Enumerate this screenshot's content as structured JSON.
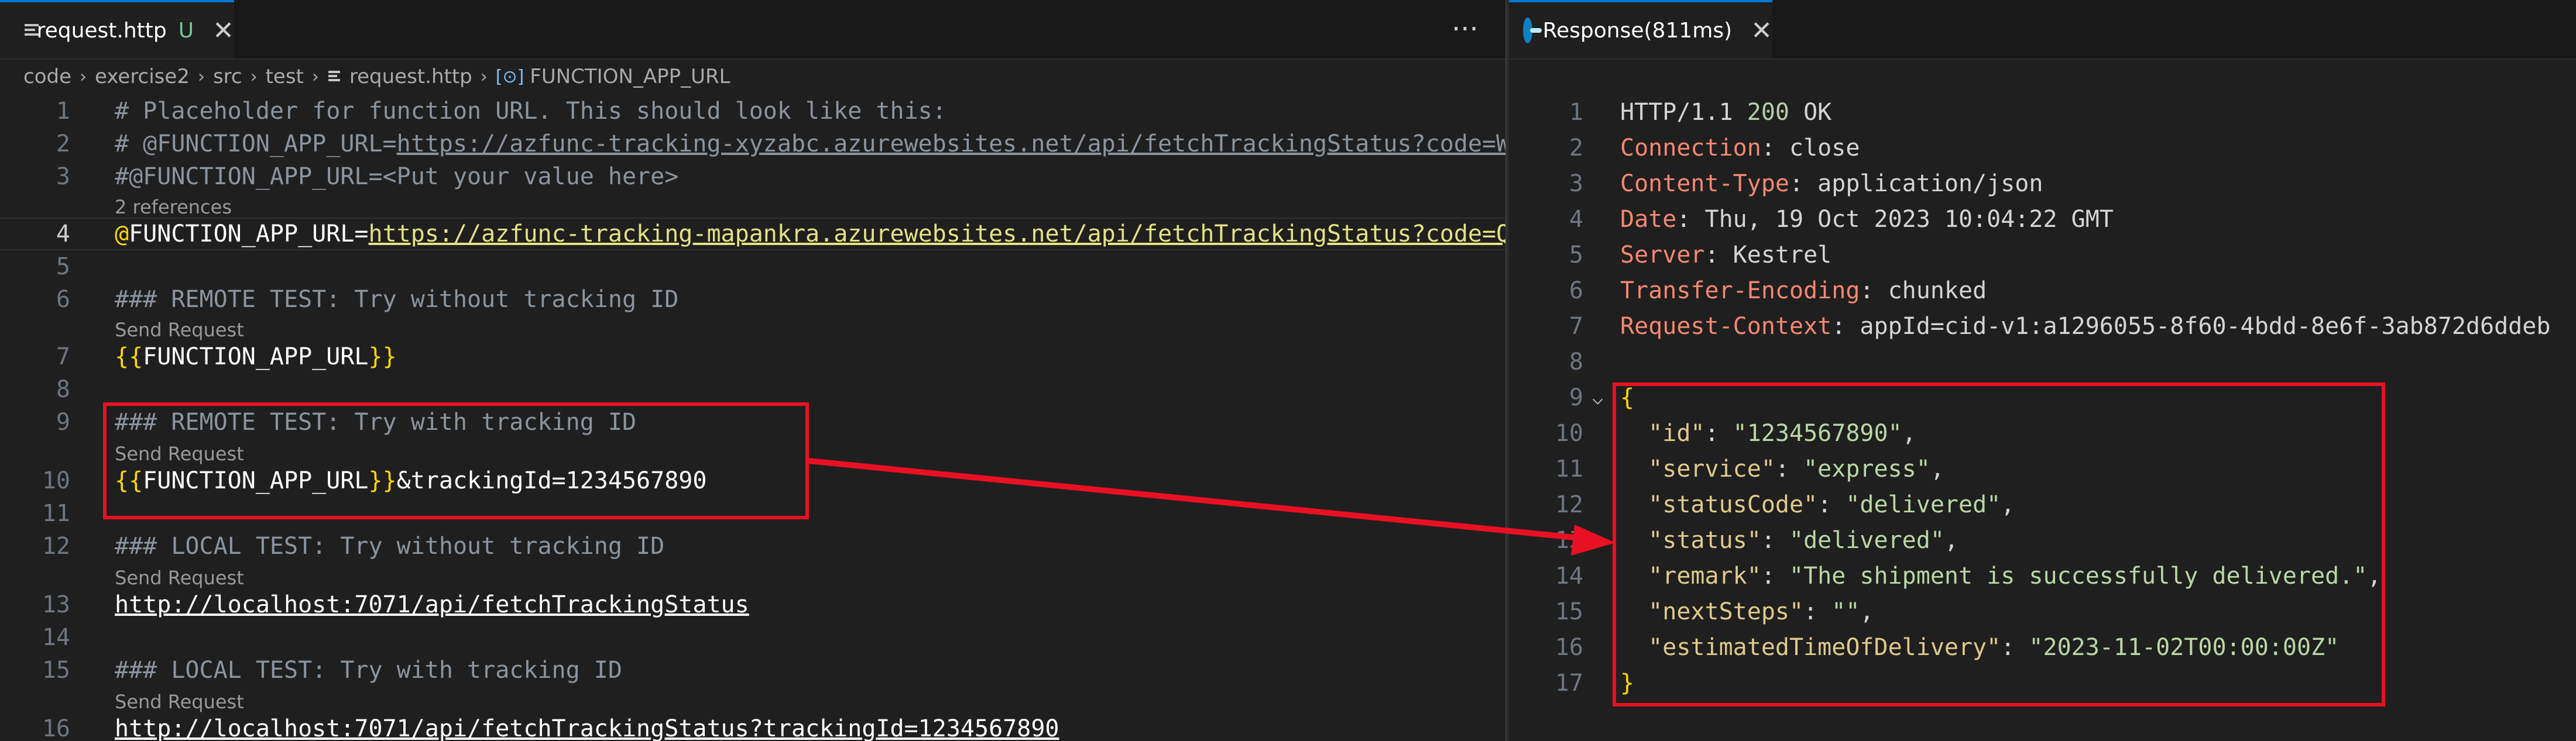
{
  "left_tab": {
    "name": "request.http",
    "status": "U",
    "close": "✕"
  },
  "more_actions": "···",
  "breadcrumb": [
    "code",
    "exercise2",
    "src",
    "test",
    "request.http",
    "FUNCTION_APP_URL"
  ],
  "right_tab": {
    "name": "Response(811ms)",
    "close": "✕"
  },
  "request_lines": [
    {
      "n": "1",
      "text": "# Placeholder for function URL. This should look like this:"
    },
    {
      "n": "2",
      "prefix": "# @FUNCTION_APP_URL=",
      "url": "https://azfunc-tracking-xyzabc.azurewebsites.net/api/fetchTrackingStatus?code=W"
    },
    {
      "n": "3",
      "text": "#@FUNCTION_APP_URL=<Put your value here>"
    },
    {
      "lens": "2 references"
    },
    {
      "n": "4",
      "at": "@",
      "var": "FUNCTION_APP_URL=",
      "url": "https://azfunc-tracking-mapankra.azurewebsites.net/api/fetchTrackingStatus?code=Q"
    },
    {
      "n": "5"
    },
    {
      "n": "6",
      "text": "### REMOTE TEST: Try without tracking ID"
    },
    {
      "lens": "Send Request"
    },
    {
      "n": "7",
      "open": "{{",
      "var": "FUNCTION_APP_URL",
      "close": "}}"
    },
    {
      "n": "8"
    },
    {
      "n": "9",
      "text": "### REMOTE TEST: Try with tracking ID"
    },
    {
      "lens": "Send Request"
    },
    {
      "n": "10",
      "open": "{{",
      "var": "FUNCTION_APP_URL",
      "close": "}}",
      "suffix": "&trackingId=1234567890"
    },
    {
      "n": "11"
    },
    {
      "n": "12",
      "text": "### LOCAL TEST: Try without tracking ID"
    },
    {
      "lens": "Send Request"
    },
    {
      "n": "13",
      "url": "http://localhost:7071/api/fetchTrackingStatus"
    },
    {
      "n": "14"
    },
    {
      "n": "15",
      "text": "### LOCAL TEST: Try with tracking ID"
    },
    {
      "lens": "Send Request"
    },
    {
      "n": "16",
      "url": "http://localhost:7071/api/fetchTrackingStatus?trackingId=1234567890"
    }
  ],
  "response_lines": [
    {
      "n": "1",
      "proto": "HTTP/1.1 ",
      "code": "200",
      "reason": " OK"
    },
    {
      "n": "2",
      "h": "Connection",
      "v": "close"
    },
    {
      "n": "3",
      "h": "Content-Type",
      "v": "application/json"
    },
    {
      "n": "4",
      "h": "Date",
      "v": "Thu, 19 Oct 2023 10:04:22 GMT"
    },
    {
      "n": "5",
      "h": "Server",
      "v": "Kestrel"
    },
    {
      "n": "6",
      "h": "Transfer-Encoding",
      "v": "chunked"
    },
    {
      "n": "7",
      "h": "Request-Context",
      "v": "appId=cid-v1:a1296055-8f60-4bdd-8e6f-3ab872d6ddeb"
    },
    {
      "n": "8"
    },
    {
      "n": "9",
      "p": "{",
      "fold": "⌵"
    },
    {
      "n": "10",
      "k": "\"id\"",
      "s": "\"1234567890\"",
      "end": ","
    },
    {
      "n": "11",
      "k": "\"service\"",
      "s": "\"express\"",
      "end": ","
    },
    {
      "n": "12",
      "k": "\"statusCode\"",
      "s": "\"delivered\"",
      "end": ","
    },
    {
      "n": "13",
      "k": "\"status\"",
      "s": "\"delivered\"",
      "end": ","
    },
    {
      "n": "14",
      "k": "\"remark\"",
      "s": "\"The shipment is successfully delivered.\"",
      "end": ","
    },
    {
      "n": "15",
      "k": "\"nextSteps\"",
      "s": "\"\"",
      "end": ","
    },
    {
      "n": "16",
      "k": "\"estimatedTimeOfDelivery\"",
      "s": "\"2023-11-02T00:00:00Z\"",
      "end": ""
    },
    {
      "n": "17",
      "p": "}"
    }
  ],
  "colors": {
    "highlight": "#e81123",
    "accent": "#0078d4"
  }
}
